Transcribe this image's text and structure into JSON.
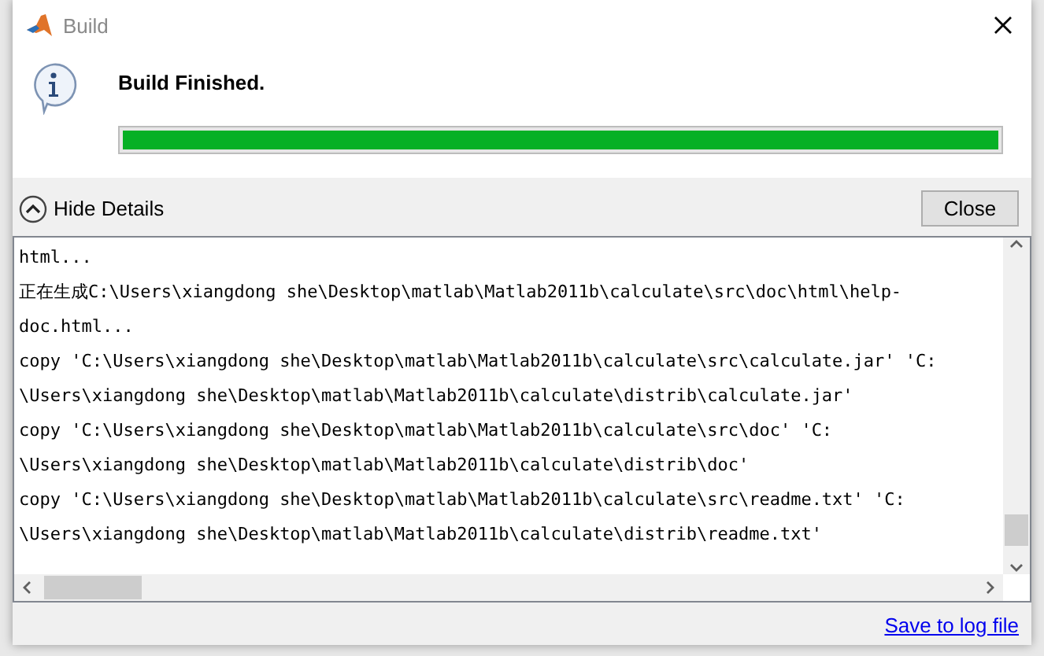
{
  "window": {
    "title": "Build"
  },
  "message": "Build Finished.",
  "progress": {
    "level": 1
  },
  "details_toggle": {
    "label": "Hide Details",
    "expanded": true
  },
  "close_button": "Close",
  "log_lines": [
    "html...",
    "正在生成C:\\Users\\xiangdong she\\Desktop\\matlab\\Matlab2011b\\calculate\\src\\doc\\html\\help-",
    "doc.html...",
    "copy 'C:\\Users\\xiangdong she\\Desktop\\matlab\\Matlab2011b\\calculate\\src\\calculate.jar' 'C:",
    "\\Users\\xiangdong she\\Desktop\\matlab\\Matlab2011b\\calculate\\distrib\\calculate.jar'",
    "copy 'C:\\Users\\xiangdong she\\Desktop\\matlab\\Matlab2011b\\calculate\\src\\doc' 'C:",
    "\\Users\\xiangdong she\\Desktop\\matlab\\Matlab2011b\\calculate\\distrib\\doc'",
    "copy 'C:\\Users\\xiangdong she\\Desktop\\matlab\\Matlab2011b\\calculate\\src\\readme.txt' 'C:",
    "\\Users\\xiangdong she\\Desktop\\matlab\\Matlab2011b\\calculate\\distrib\\readme.txt'"
  ],
  "save_link": "Save to log file"
}
